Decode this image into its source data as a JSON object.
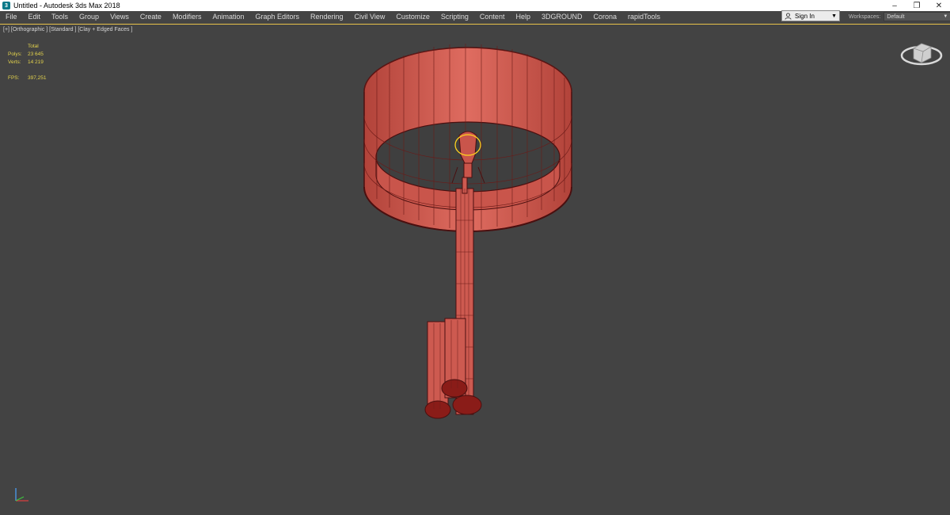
{
  "window": {
    "title": "Untitled - Autodesk 3ds Max 2018",
    "icon": "3ds-max-app-icon",
    "controls": {
      "minimize": "–",
      "restore": "❐",
      "close": "✕"
    }
  },
  "menu": {
    "items": [
      "File",
      "Edit",
      "Tools",
      "Group",
      "Views",
      "Create",
      "Modifiers",
      "Animation",
      "Graph Editors",
      "Rendering",
      "Civil View",
      "Customize",
      "Scripting",
      "Content",
      "Help",
      "3DGROUND",
      "Corona",
      "rapidTools"
    ]
  },
  "account": {
    "signin_label": "Sign In",
    "icon": "user-icon"
  },
  "workspaces": {
    "label": "Workspaces:",
    "value": "Default"
  },
  "viewport": {
    "label": "[+] [Orthographic ] [Standard ] [Clay + Edged Faces ]",
    "stats": {
      "header": "Total",
      "polys_label": "Polys:",
      "polys_value": "23 645",
      "verts_label": "Verts:",
      "verts_value": "14 219",
      "fps_label": "FPS:",
      "fps_value": "397,251"
    },
    "colors": {
      "background": "#434343",
      "model_fill": "#d15a4f",
      "model_edges": "#4a0f0f",
      "selection": "#ffd21e",
      "stats_text": "#e4d34c",
      "active_border": "#e7c24a"
    },
    "gizmos": {
      "viewcube": "viewcube-icon",
      "axis": "axis-tripod-icon"
    }
  }
}
